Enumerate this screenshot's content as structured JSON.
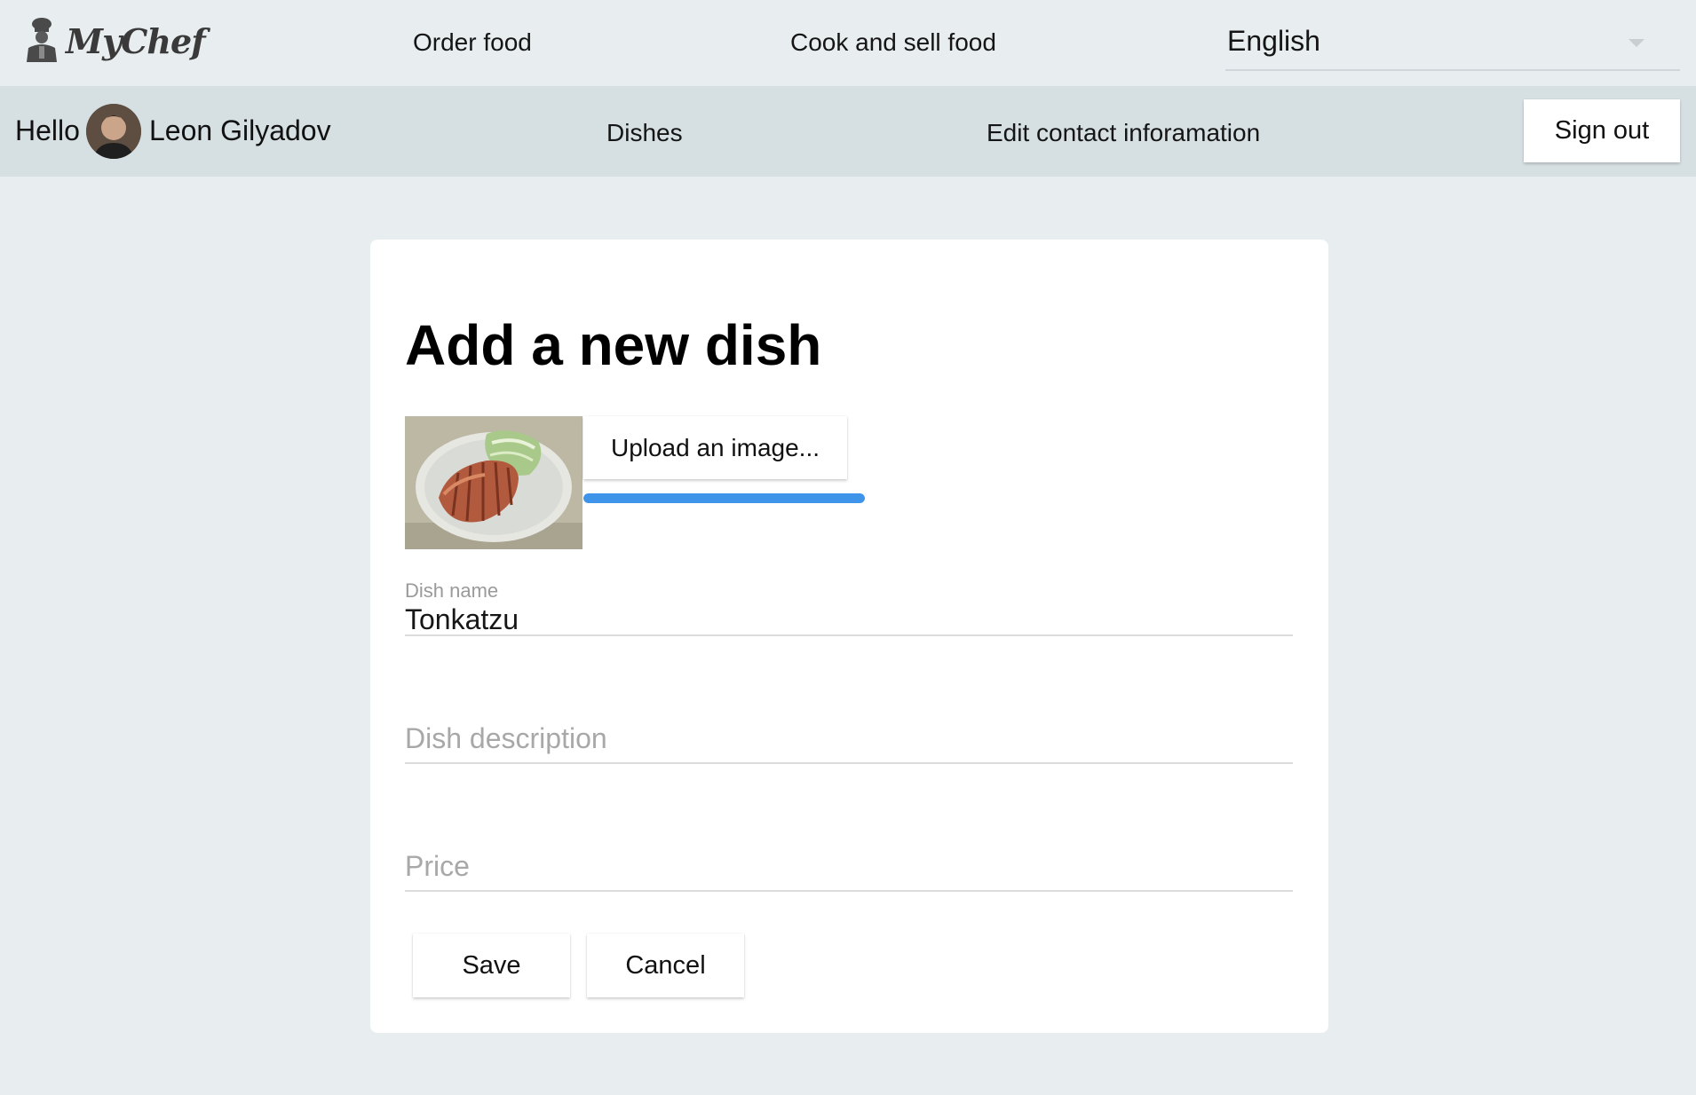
{
  "app": {
    "brand": "MyChef"
  },
  "topbar": {
    "nav": [
      "Order food",
      "Cook and sell food"
    ],
    "language": {
      "selected": "English"
    }
  },
  "userbar": {
    "greeting": "Hello",
    "username": "Leon Gilyadov",
    "nav": [
      "Dishes",
      "Edit contact inforamation"
    ],
    "signout_label": "Sign out"
  },
  "form": {
    "title": "Add a new dish",
    "upload_label": "Upload an image...",
    "upload_progress": 1.0,
    "dish_name": {
      "label": "Dish name",
      "value": "Tonkatzu"
    },
    "dish_description": {
      "placeholder": "Dish description",
      "value": ""
    },
    "price": {
      "placeholder": "Price",
      "value": ""
    },
    "save_label": "Save",
    "cancel_label": "Cancel"
  },
  "colors": {
    "background": "#e8edf0",
    "userbar": "#d6e0e3",
    "progress": "#3d94e8"
  },
  "icons": {
    "logo": "chef-icon",
    "dropdown": "caret-down-icon"
  }
}
